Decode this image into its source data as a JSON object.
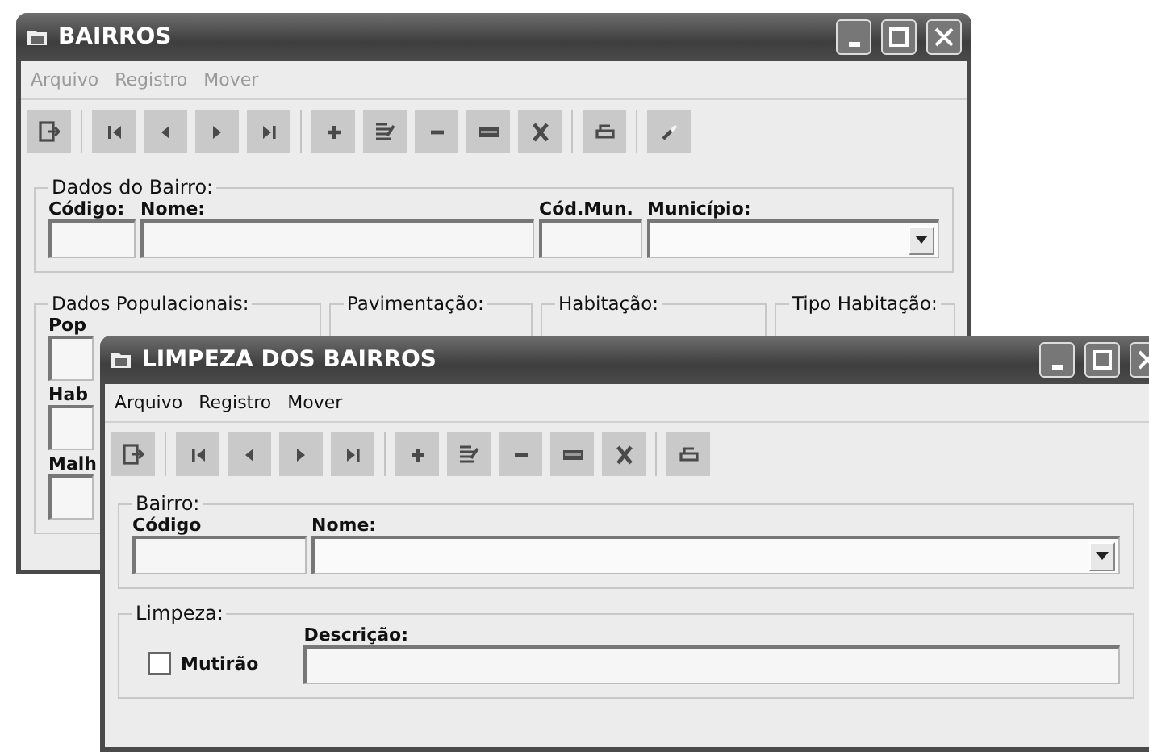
{
  "back_window": {
    "title": "BAIRROS",
    "menu": [
      {
        "label": "Arquivo",
        "disabled": true
      },
      {
        "label": "Registro",
        "disabled": true
      },
      {
        "label": "Mover",
        "disabled": true
      }
    ],
    "toolbar": [
      [
        {
          "kind": "exit"
        }
      ],
      [
        {
          "kind": "first"
        },
        {
          "kind": "prev"
        },
        {
          "kind": "next"
        },
        {
          "kind": "last"
        }
      ],
      [
        {
          "kind": "add"
        },
        {
          "kind": "edit"
        },
        {
          "kind": "remove"
        },
        {
          "kind": "save"
        },
        {
          "kind": "cancel"
        }
      ],
      [
        {
          "kind": "print"
        }
      ],
      [
        {
          "kind": "brush"
        }
      ]
    ],
    "bairro_group": {
      "legend": "Dados do Bairro:",
      "fields": [
        {
          "label": "Código:",
          "kind": "text"
        },
        {
          "label": "Nome:",
          "kind": "text"
        },
        {
          "label": "Cód.Mun.",
          "kind": "text"
        },
        {
          "label": "Município:",
          "kind": "combo"
        }
      ]
    },
    "lower_groups": [
      {
        "legend": "Dados Populacionais:",
        "fields": [
          {
            "label": "Pop",
            "kind": "text"
          },
          {
            "label": "Hab",
            "kind": "text"
          },
          {
            "label": "Malh",
            "kind": "text"
          }
        ]
      },
      {
        "legend": "Pavimentação:"
      },
      {
        "legend": "Habitação:"
      },
      {
        "legend": "Tipo Habitação:"
      }
    ]
  },
  "front_window": {
    "title": "LIMPEZA DOS BAIRROS",
    "menu": [
      {
        "label": "Arquivo",
        "disabled": false
      },
      {
        "label": "Registro",
        "disabled": false
      },
      {
        "label": "Mover",
        "disabled": false
      }
    ],
    "toolbar": [
      [
        {
          "kind": "exit"
        }
      ],
      [
        {
          "kind": "first"
        },
        {
          "kind": "prev"
        },
        {
          "kind": "next"
        },
        {
          "kind": "last"
        }
      ],
      [
        {
          "kind": "add"
        },
        {
          "kind": "edit"
        },
        {
          "kind": "remove"
        },
        {
          "kind": "save"
        },
        {
          "kind": "cancel"
        }
      ],
      [
        {
          "kind": "print"
        }
      ]
    ],
    "bairro_group": {
      "legend": "Bairro:",
      "fields": [
        {
          "label": "Código",
          "kind": "text"
        },
        {
          "label": "Nome:",
          "kind": "combo"
        }
      ]
    },
    "limpeza_group": {
      "legend": "Limpeza:",
      "checkbox": {
        "label": "Mutirão",
        "checked": false
      },
      "fields": [
        {
          "label": "Descrição:",
          "kind": "text"
        }
      ]
    }
  }
}
